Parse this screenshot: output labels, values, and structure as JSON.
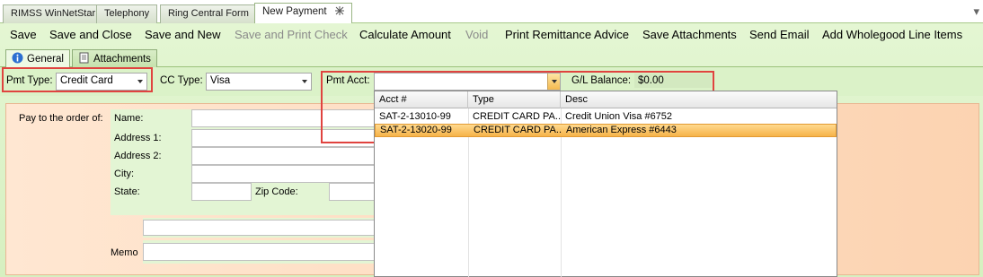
{
  "doc_tabs": [
    {
      "label": "RIMSS WinNetStar"
    },
    {
      "label": "Telephony"
    },
    {
      "label": "Ring Central Form"
    },
    {
      "label": "New Payment"
    }
  ],
  "toolbar": {
    "save": "Save",
    "save_close": "Save and Close",
    "save_new": "Save and New",
    "save_print_check": "Save and Print Check",
    "calculate_amount": "Calculate Amount",
    "void": "Void",
    "print_remittance": "Print Remittance Advice",
    "save_attachments": "Save Attachments",
    "send_email": "Send Email",
    "add_wholegood": "Add Wholegood Line Items"
  },
  "subtabs": {
    "general": "General",
    "attachments": "Attachments"
  },
  "filters": {
    "pmt_type_label": "Pmt Type:",
    "pmt_type_value": "Credit Card",
    "cc_type_label": "CC Type:",
    "cc_type_value": "Visa",
    "pmt_acct_label": "Pmt Acct:",
    "pmt_acct_value": "",
    "gl_balance_label": "G/L Balance:",
    "gl_balance_value": "$0.00"
  },
  "form": {
    "pay_to_label": "Pay to the order of:",
    "name_label": "Name:",
    "address1_label": "Address 1:",
    "address2_label": "Address 2:",
    "city_label": "City:",
    "state_label": "State:",
    "zip_label": "Zip Code:",
    "memo_label": "Memo"
  },
  "account_dropdown": {
    "columns": [
      "Acct #",
      "Type",
      "Desc"
    ],
    "rows": [
      {
        "acct": "SAT-2-13010-99",
        "type": "CREDIT CARD PA...",
        "desc": "Credit Union Visa #6752",
        "selected": false
      },
      {
        "acct": "SAT-2-13020-99",
        "type": "CREDIT CARD PA...",
        "desc": "American Express #6443",
        "selected": true
      }
    ]
  },
  "colors": {
    "highlight_red": "#e0433f",
    "selected_row": "#f6b349",
    "panel_green": "#dbf2c8"
  }
}
